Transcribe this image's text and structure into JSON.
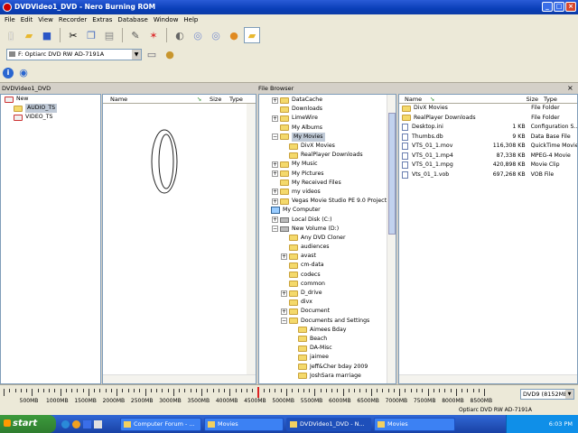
{
  "window": {
    "title": "DVDVideo1_DVD - Nero Burning ROM"
  },
  "menu": [
    "File",
    "Edit",
    "View",
    "Recorder",
    "Extras",
    "Database",
    "Window",
    "Help"
  ],
  "drive_select": {
    "value": "F: Optiarc DVD RW AD-7191A"
  },
  "compilation": {
    "header": "DVDVideo1_DVD",
    "tree": [
      {
        "label": "New",
        "level": 0,
        "icon": "red-folder"
      },
      {
        "label": "AUDIO_TS",
        "level": 1,
        "icon": "folder",
        "selected": true
      },
      {
        "label": "VIDEO_TS",
        "level": 1,
        "icon": "red-folder"
      }
    ],
    "columns": [
      "Name",
      "Size",
      "Type"
    ]
  },
  "file_browser": {
    "header": "File Browser",
    "tree": [
      {
        "label": "DataCache",
        "level": 1,
        "expander": "+"
      },
      {
        "label": "Downloads",
        "level": 1,
        "expander": ""
      },
      {
        "label": "LimeWire",
        "level": 1,
        "expander": "+"
      },
      {
        "label": "My Albums",
        "level": 1,
        "expander": ""
      },
      {
        "label": "My Movies",
        "level": 1,
        "expander": "-",
        "selected": true
      },
      {
        "label": "DivX Movies",
        "level": 2,
        "expander": ""
      },
      {
        "label": "RealPlayer Downloads",
        "level": 2,
        "expander": ""
      },
      {
        "label": "My Music",
        "level": 1,
        "expander": "+"
      },
      {
        "label": "My Pictures",
        "level": 1,
        "expander": "+"
      },
      {
        "label": "My Received Files",
        "level": 1,
        "expander": ""
      },
      {
        "label": "my videos",
        "level": 1,
        "expander": "+"
      },
      {
        "label": "Vegas Movie Studio PE 9.0 Projects",
        "level": 1,
        "expander": "+"
      },
      {
        "label": "My Computer",
        "level": 0,
        "expander": "",
        "icon": "pc"
      },
      {
        "label": "Local Disk (C:)",
        "level": 1,
        "expander": "+",
        "icon": "drive"
      },
      {
        "label": "New Volume (D:)",
        "level": 1,
        "expander": "-",
        "icon": "drive"
      },
      {
        "label": "Any DVD Cloner",
        "level": 2,
        "expander": ""
      },
      {
        "label": "audiences",
        "level": 2,
        "expander": ""
      },
      {
        "label": "avast",
        "level": 2,
        "expander": "+"
      },
      {
        "label": "cm-data",
        "level": 2,
        "expander": ""
      },
      {
        "label": "codecs",
        "level": 2,
        "expander": ""
      },
      {
        "label": "common",
        "level": 2,
        "expander": ""
      },
      {
        "label": "D_drive",
        "level": 2,
        "expander": "+"
      },
      {
        "label": "divx",
        "level": 2,
        "expander": ""
      },
      {
        "label": "Document",
        "level": 2,
        "expander": "+"
      },
      {
        "label": "Documents and Settings",
        "level": 2,
        "expander": "-"
      },
      {
        "label": "Aimees Bday",
        "level": 3,
        "expander": ""
      },
      {
        "label": "Beach",
        "level": 3,
        "expander": ""
      },
      {
        "label": "DA-Misc",
        "level": 3,
        "expander": ""
      },
      {
        "label": "jaimee",
        "level": 3,
        "expander": ""
      },
      {
        "label": "Jeff&Cher bday 2009",
        "level": 3,
        "expander": ""
      },
      {
        "label": "JoshSara marriage",
        "level": 3,
        "expander": ""
      }
    ],
    "columns": [
      "Name",
      "Size",
      "Type"
    ],
    "files": [
      {
        "name": "DivX Movies",
        "size": "",
        "type": "File Folder",
        "icon": "folder"
      },
      {
        "name": "RealPlayer Downloads",
        "size": "",
        "type": "File Folder",
        "icon": "folder"
      },
      {
        "name": "Desktop.ini",
        "size": "1 KB",
        "type": "Configuration S...",
        "icon": "file"
      },
      {
        "name": "Thumbs.db",
        "size": "9 KB",
        "type": "Data Base File",
        "icon": "file"
      },
      {
        "name": "VTS_01_1.mov",
        "size": "116,308 KB",
        "type": "QuickTime Movie",
        "icon": "file"
      },
      {
        "name": "VTS_01_1.mp4",
        "size": "87,338 KB",
        "type": "MPEG-4 Movie",
        "icon": "file"
      },
      {
        "name": "VTS_01_1.mpg",
        "size": "420,898 KB",
        "type": "Movie Clip",
        "icon": "file"
      },
      {
        "name": "Vts_01_1.vob",
        "size": "697,268 KB",
        "type": "VOB File",
        "icon": "file"
      }
    ]
  },
  "ruler": {
    "labels": [
      "500MB",
      "1000MB",
      "1500MB",
      "2000MB",
      "2500MB",
      "3000MB",
      "3500MB",
      "4000MB",
      "4500MB",
      "5000MB",
      "5500MB",
      "6000MB",
      "6500MB",
      "7000MB",
      "7500MB",
      "8000MB",
      "8500MB"
    ],
    "disc_select": "DVD9 (8152MB"
  },
  "status": {
    "recorder": "Optiarc  DVD RW AD-7191A"
  },
  "taskbar": {
    "start": "start",
    "tasks": [
      {
        "label": "Computer Forum - ...",
        "active": false
      },
      {
        "label": "Movies",
        "active": false
      },
      {
        "label": "DVDVideo1_DVD - N...",
        "active": true
      },
      {
        "label": "Movies",
        "active": false
      }
    ],
    "clock": "6:03 PM"
  },
  "colors": {
    "titlebar": "#0a3fb8",
    "selection": "#bfc9d6",
    "taskbar": "#245edb"
  }
}
